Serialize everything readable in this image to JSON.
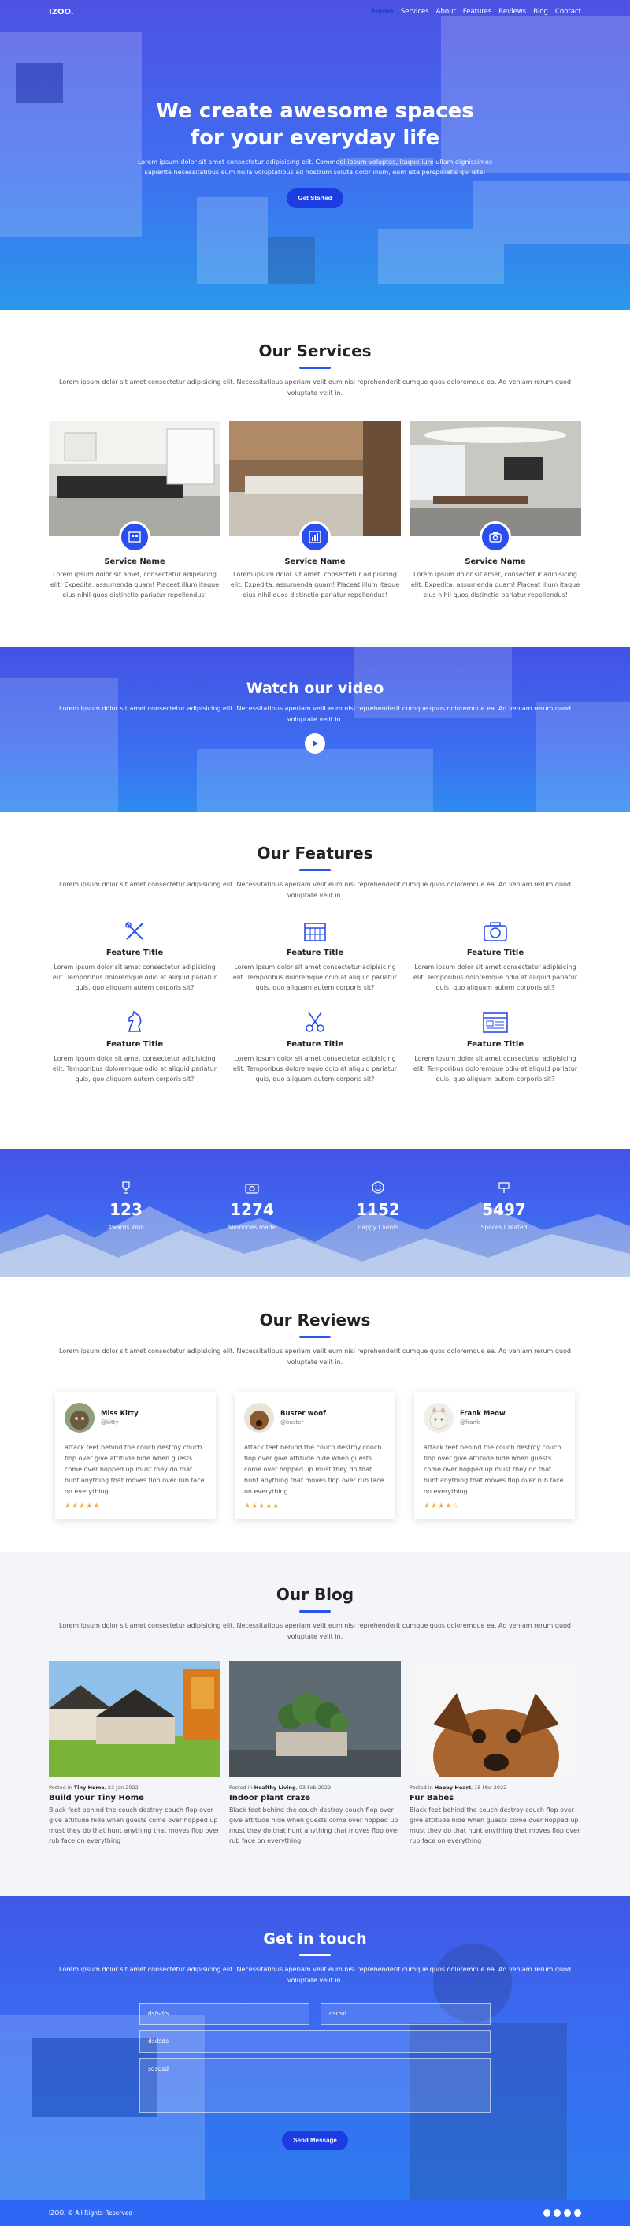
{
  "nav": {
    "logo": "IZOO.",
    "items": [
      "Home",
      "Services",
      "About",
      "Features",
      "Reviews",
      "Blog",
      "Contact"
    ]
  },
  "hero": {
    "title_line1": "We create awesome spaces",
    "title_line2": "for your everyday life",
    "text": "Lorem ipsum dolor sit amet consectetur adipisicing elit. Commodi ipsum voluptas, itaque iure ullam dignissimos sapiente necessitatibus eum nulla voluptatibus ad nostrum soluta dolor illum, eum iste perspiciatis qui iste!",
    "cta": "Get Started"
  },
  "services": {
    "title": "Our Services",
    "lead": "Lorem ipsum dolor sit amet consectetur adipisicing elit. Necessitatibus aperiam velit eum nisi reprehenderit cumque quos doloremque ea. Ad veniam rerum quod voluptate velit in.",
    "items": [
      {
        "name": "Service Name",
        "text": "Lorem ipsum dolor sit amet, consectetur adipisicing elit. Expedita, assumenda quam! Placeat illum itaque eius nihil quos distinctio pariatur repellendus!"
      },
      {
        "name": "Service Name",
        "text": "Lorem ipsum dolor sit amet, consectetur adipisicing elit. Expedita, assumenda quam! Placeat illum itaque eius nihil quos distinctio pariatur repellendus!"
      },
      {
        "name": "Service Name",
        "text": "Lorem ipsum dolor sit amet, consectetur adipisicing elit. Expedita, assumenda quam! Placeat illum itaque eius nihil quos distinctio pariatur repellendus!"
      }
    ]
  },
  "video": {
    "title": "Watch our video",
    "text": "Lorem ipsum dolor sit amet consectetur adipisicing elit. Necessitatibus aperiam velit eum nisi reprehenderit cumque quos doloremque ea. Ad veniam rerum quod voluptate velit in."
  },
  "features": {
    "title": "Our Features",
    "lead": "Lorem ipsum dolor sit amet consectetur adipisicing elit. Necessitatibus aperiam velit eum nisi reprehenderit cumque quos doloremque ea. Ad veniam rerum quod voluptate velit in.",
    "items": [
      {
        "title": "Feature Title",
        "text": "Lorem ipsum dolor sit amet consectetur adipisicing elit. Temporibus doloremque odio at aliquid pariatur quis, quo aliquam autem corporis sit?",
        "icon": "design-tools-icon"
      },
      {
        "title": "Feature Title",
        "text": "Lorem ipsum dolor sit amet consectetur adipisicing elit. Temporibus doloremque odio at aliquid pariatur quis, quo aliquam autem corporis sit?",
        "icon": "calendar-icon"
      },
      {
        "title": "Feature Title",
        "text": "Lorem ipsum dolor sit amet consectetur adipisicing elit. Temporibus doloremque odio at aliquid pariatur quis, quo aliquam autem corporis sit?",
        "icon": "camera-icon"
      },
      {
        "title": "Feature Title",
        "text": "Lorem ipsum dolor sit amet consectetur adipisicing elit. Temporibus doloremque odio at aliquid pariatur quis, quo aliquam autem corporis sit?",
        "icon": "chess-knight-icon"
      },
      {
        "title": "Feature Title",
        "text": "Lorem ipsum dolor sit amet consectetur adipisicing elit. Temporibus doloremque odio at aliquid pariatur quis, quo aliquam autem corporis sit?",
        "icon": "scissors-icon"
      },
      {
        "title": "Feature Title",
        "text": "Lorem ipsum dolor sit amet consectetur adipisicing elit. Temporibus doloremque odio at aliquid pariatur quis, quo aliquam autem corporis sit?",
        "icon": "browser-window-icon"
      }
    ]
  },
  "counters": [
    {
      "num": "123",
      "label": "Awards Won",
      "icon": "trophy-icon"
    },
    {
      "num": "1274",
      "label": "Memories made",
      "icon": "camera-icon"
    },
    {
      "num": "1152",
      "label": "Happy Clients",
      "icon": "smile-icon"
    },
    {
      "num": "5497",
      "label": "Spaces Created",
      "icon": "sign-icon"
    }
  ],
  "reviews": {
    "title": "Our Reviews",
    "lead": "Lorem ipsum dolor sit amet consectetur adipisicing elit. Necessitatibus aperiam velit eum nisi reprehenderit cumque quos doloremque ea. Ad veniam rerum quod voluptate velit in.",
    "items": [
      {
        "name": "Miss Kitty",
        "handle": "@kitty",
        "text": "attack feet behind the couch destroy couch flop over give attitude hide when guests come over hopped up must they do that hunt anything that moves flop over rub face on everything",
        "stars": "★★★★★"
      },
      {
        "name": "Buster woof",
        "handle": "@buster",
        "text": "attack feet behind the couch destroy couch flop over give attitude hide when guests come over hopped up must they do that hunt anything that moves flop over rub face on everything",
        "stars": "★★★★★"
      },
      {
        "name": "Frank Meow",
        "handle": "@frank",
        "text": "attack feet behind the couch destroy couch flop over give attitude hide when guests come over hopped up must they do that hunt anything that moves flop over rub face on everything",
        "stars": "★★★★☆"
      }
    ]
  },
  "blog": {
    "title": "Our Blog",
    "lead": "Lorem ipsum dolor sit amet consectetur adipisicing elit. Necessitatibus aperiam velit eum nisi reprehenderit cumque quos doloremque ea. Ad veniam rerum quod voluptate velit in.",
    "posts": [
      {
        "meta_prefix": "Posted in",
        "category": "Tiny Home",
        "date": "23 Jan 2022",
        "title": "Build your Tiny Home",
        "text": "Black feet behind the couch destroy couch flop over give attitude hide when guests come over hopped up must they do that hunt anything that moves flop over rub face on everything"
      },
      {
        "meta_prefix": "Posted in",
        "category": "Healthy Living",
        "date": "03 Feb 2022",
        "title": "Indoor plant craze",
        "text": "Black feet behind the couch destroy couch flop over give attitude hide when guests come over hopped up must they do that hunt anything that moves flop over rub face on everything"
      },
      {
        "meta_prefix": "Posted in",
        "category": "Happy Heart",
        "date": "15 Mar 2022",
        "title": "Fur Babes",
        "text": "Black feet behind the couch destroy couch flop over give attitude hide when guests come over hopped up must they do that hunt anything that moves flop over rub face on everything"
      }
    ]
  },
  "contact": {
    "title": "Get in touch",
    "lead": "Lorem ipsum dolor sit amet consectetur adipisicing elit. Necessitatibus aperiam velit eum nisi reprehenderit cumque quos doloremque ea. Ad veniam rerum quod voluptate velit in.",
    "f1": "dsfsdfs",
    "f2": "dsdsd",
    "f3": "dsdsds",
    "msg": "sdsdsd",
    "send": "Send Message"
  },
  "footer": {
    "copy": "IZOO. © All Rights Reserved",
    "social": [
      "facebook-icon",
      "twitter-icon",
      "instagram-icon",
      "github-icon"
    ]
  }
}
